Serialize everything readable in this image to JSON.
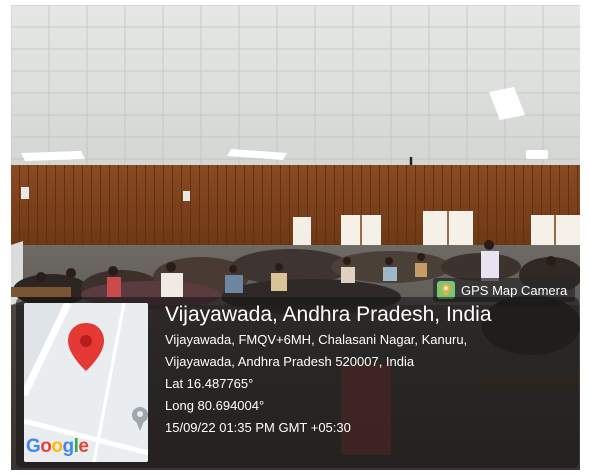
{
  "badge": {
    "label": "GPS Map Camera",
    "icon": "map-pin-icon"
  },
  "location": {
    "title": "Vijayawada, Andhra Pradesh, India",
    "address_line1": "Vijayawada, FMQV+6MH, Chalasani Nagar, Kanuru,",
    "address_line2": "Vijayawada, Andhra Pradesh 520007, India",
    "lat": "Lat 16.487765°",
    "long": "Long 80.694004°",
    "timestamp": "15/09/22 01:35 PM GMT +05:30"
  },
  "map": {
    "logo_text": "Google",
    "logo_letters": [
      "G",
      "o",
      "o",
      "g",
      "l",
      "e"
    ],
    "logo_colors": [
      "#4285F4",
      "#EA4335",
      "#FBBC05",
      "#4285F4",
      "#34A853",
      "#EA4335"
    ],
    "pin_color": "#E53935"
  }
}
